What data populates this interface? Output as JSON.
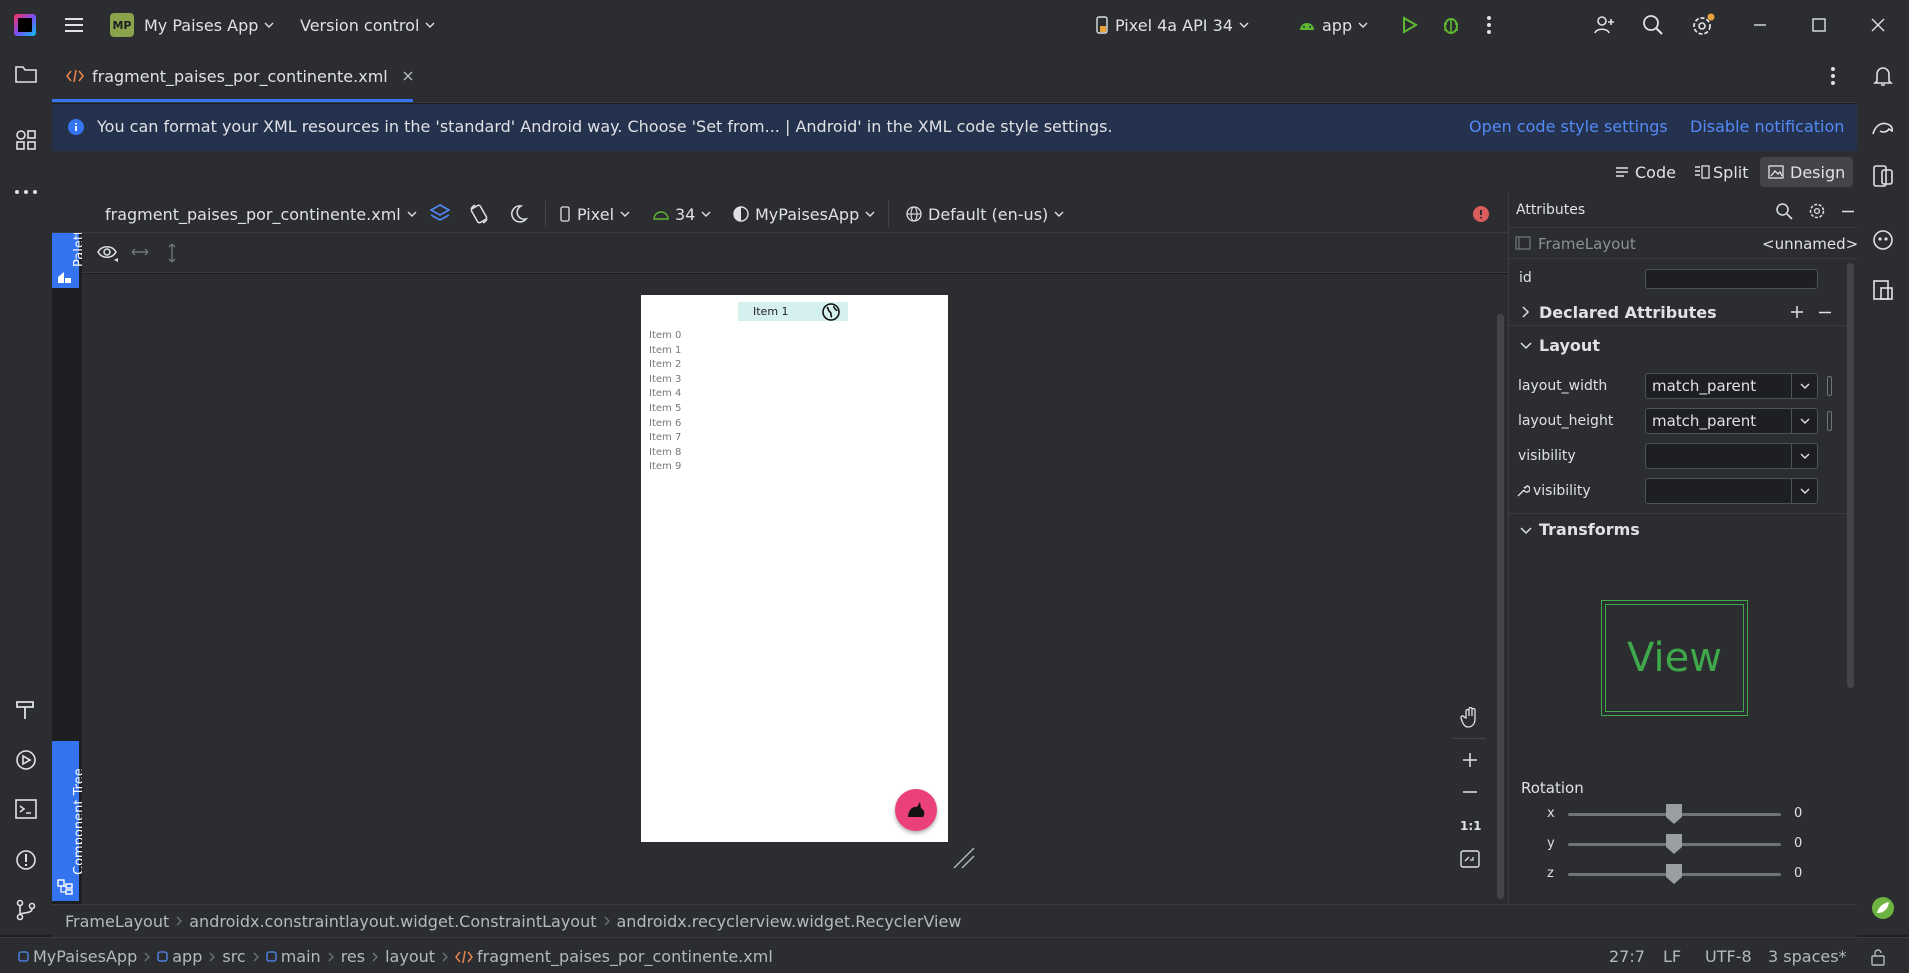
{
  "titlebar": {
    "project_badge": "MP",
    "project_name": "My Paises App",
    "vcs": "Version control",
    "device": "Pixel 4a API 34",
    "run_config": "app"
  },
  "editor": {
    "tab_label": "fragment_paises_por_continente.xml"
  },
  "notification": {
    "message": "You can format your XML resources in the 'standard' Android way. Choose 'Set from... | Android' in the XML code style settings.",
    "action_open": "Open code style settings",
    "action_disable": "Disable notification"
  },
  "modes": {
    "code": "Code",
    "split": "Split",
    "design": "Design"
  },
  "toolbar": {
    "file": "fragment_paises_por_continente.xml",
    "device": "Pixel",
    "api": "34",
    "theme": "MyPaisesApp",
    "locale": "Default (en-us)"
  },
  "side_tabs": {
    "palette": "Palette",
    "component_tree": "Component Tree"
  },
  "preview": {
    "selected_item": "Item 1",
    "items": [
      "Item 0",
      "Item 1",
      "Item 2",
      "Item 3",
      "Item 4",
      "Item 5",
      "Item 6",
      "Item 7",
      "Item 8",
      "Item 9"
    ]
  },
  "zoom": {
    "one_to_one": "1:1"
  },
  "attributes": {
    "title": "Attributes",
    "component": "FrameLayout",
    "component_name": "<unnamed>",
    "id_label": "id",
    "id_value": "",
    "declared_section": "Declared Attributes",
    "layout_section": "Layout",
    "layout_width_label": "layout_width",
    "layout_width_value": "match_parent",
    "layout_height_label": "layout_height",
    "layout_height_value": "match_parent",
    "visibility_label": "visibility",
    "tools_visibility_label": "visibility",
    "transforms_section": "Transforms",
    "view_preview": "View",
    "rotation_label": "Rotation",
    "rotation": [
      {
        "axis": "x",
        "value": "0"
      },
      {
        "axis": "y",
        "value": "0"
      },
      {
        "axis": "z",
        "value": "0"
      }
    ]
  },
  "breadcrumb": [
    "FrameLayout",
    "androidx.constraintlayout.widget.ConstraintLayout",
    "androidx.recyclerview.widget.RecyclerView"
  ],
  "statusbar": {
    "path": [
      "MyPaisesApp",
      "app",
      "src",
      "main",
      "res",
      "layout",
      "fragment_paises_por_continente.xml"
    ],
    "position": "27:7",
    "line_sep": "LF",
    "encoding": "UTF-8",
    "indent": "3 spaces*"
  },
  "colors": {
    "accent": "#3574f0",
    "fab": "#ec407a",
    "view_green": "#3ea84a",
    "error": "#db5c5c"
  }
}
